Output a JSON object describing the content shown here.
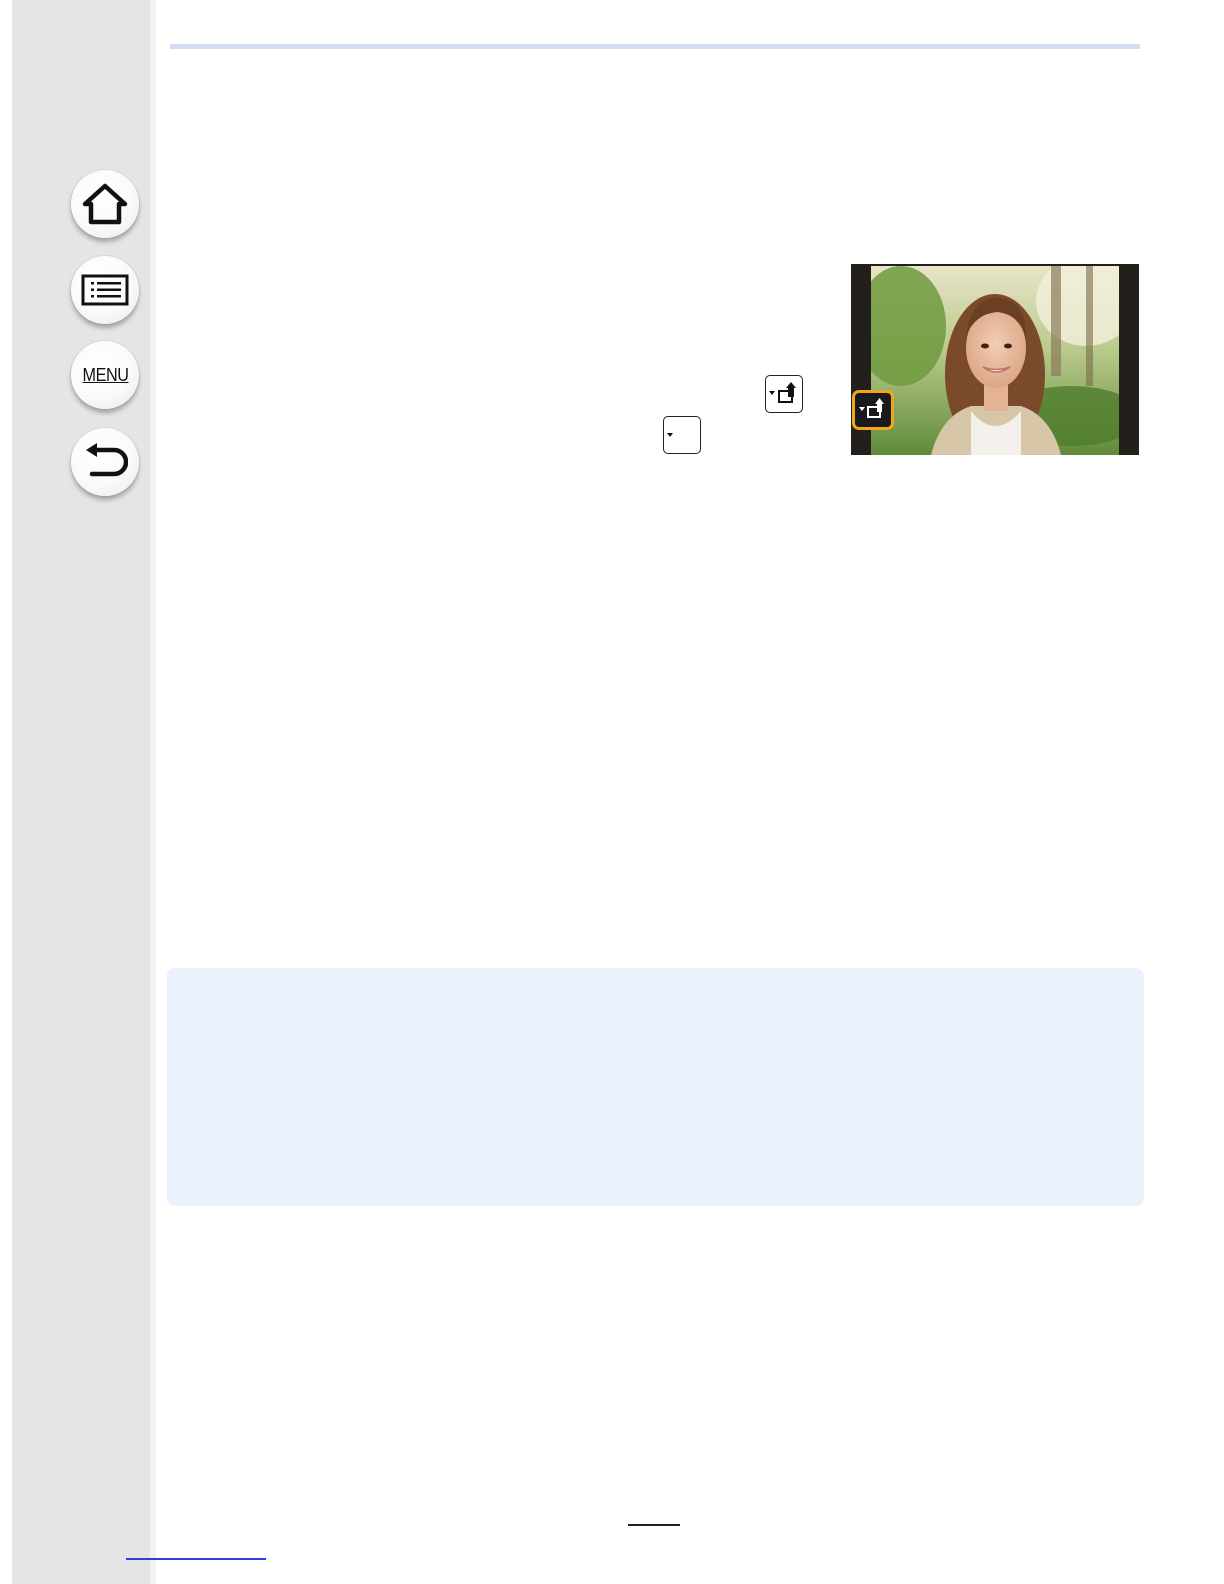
{
  "nav": {
    "home_icon": "home-icon",
    "contents_icon": "list-icon",
    "menu_label": "MENU",
    "back_icon": "back-arrow-icon"
  },
  "colors": {
    "sidebar": "#e5e5e5",
    "accent_rule": "#d4dcf2",
    "note_background": "#ebf2fd",
    "highlight_orange": "#f2a51c",
    "link_blue": "#2b3ee0"
  },
  "icons": {
    "inline_key_full": "dropdown-move-up-icon",
    "inline_key_small": "dropdown-icon",
    "overlay_key": "dropdown-move-up-icon"
  }
}
